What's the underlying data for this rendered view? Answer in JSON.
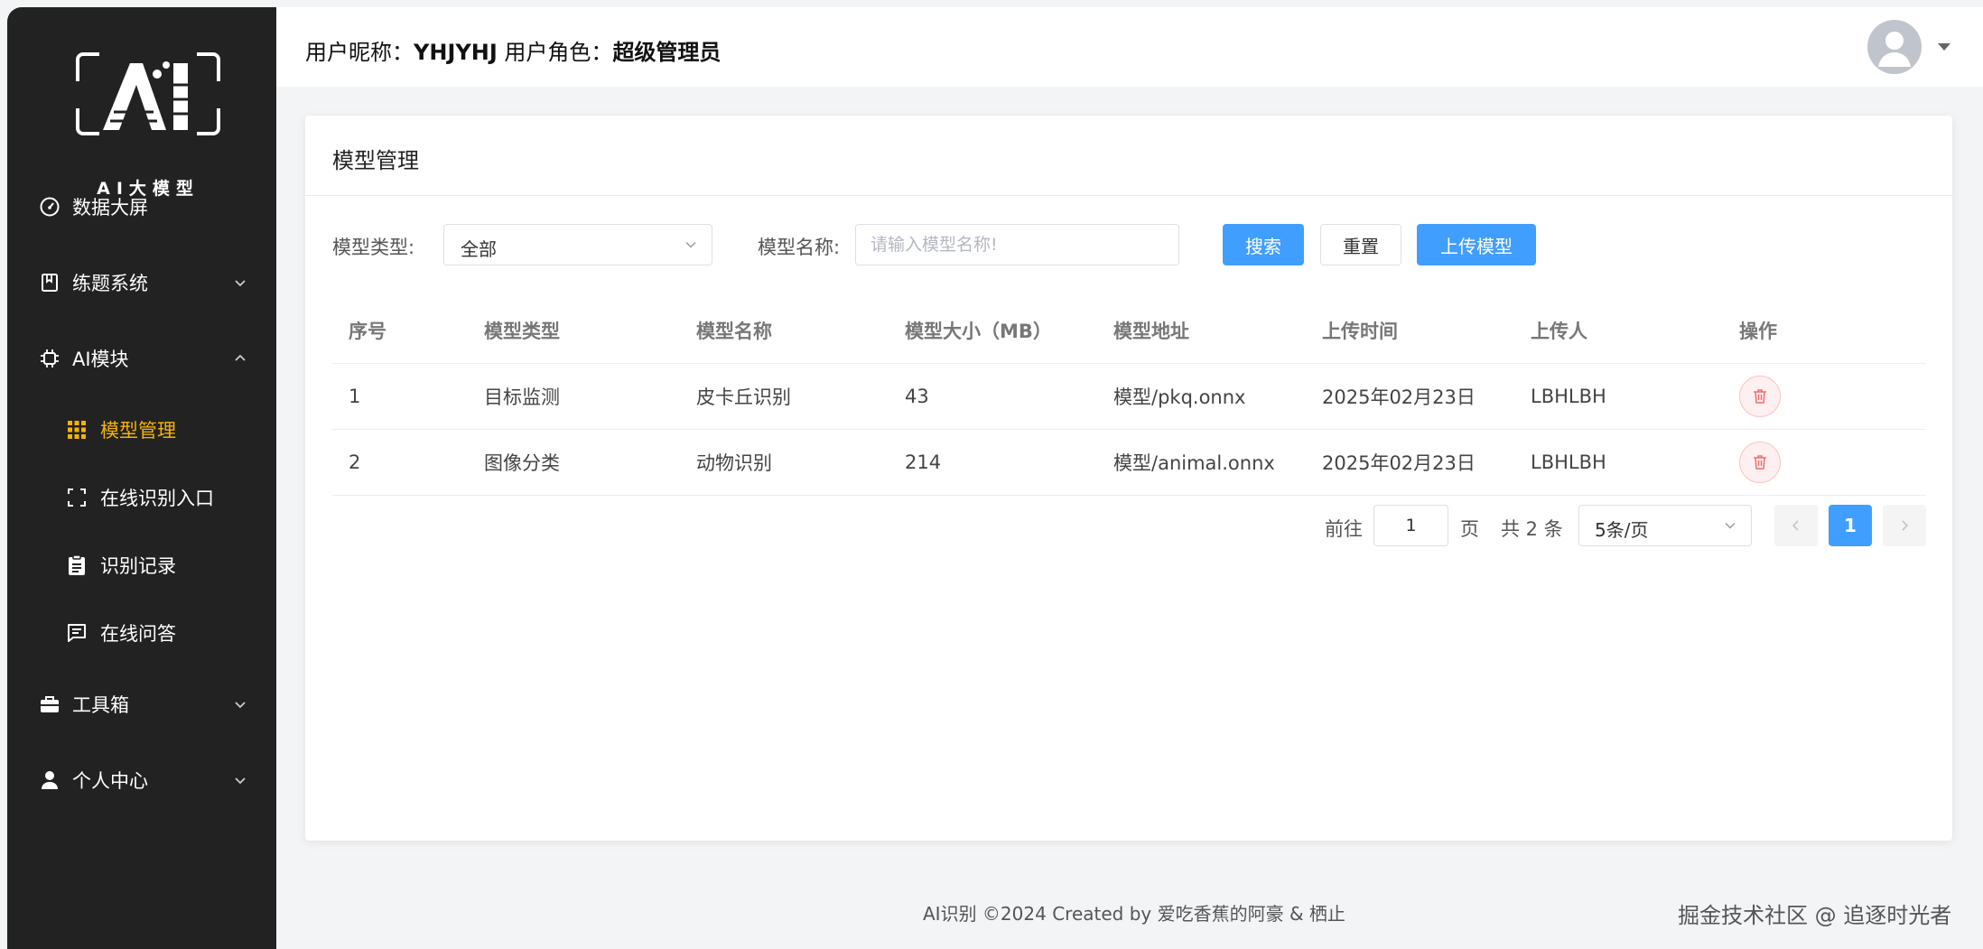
{
  "sidebar": {
    "logo_text": "AI大模型",
    "items": [
      {
        "label": "数据大屏",
        "icon": "dashboard-icon"
      },
      {
        "label": "练题系统",
        "icon": "book-icon"
      },
      {
        "label": "AI模块",
        "icon": "chip-icon"
      },
      {
        "label": "工具箱",
        "icon": "toolbox-icon"
      },
      {
        "label": "个人中心",
        "icon": "user-icon"
      }
    ],
    "ai_sub_items": [
      {
        "label": "模型管理",
        "icon": "grid-icon"
      },
      {
        "label": "在线识别入口",
        "icon": "scan-icon"
      },
      {
        "label": "识别记录",
        "icon": "clipboard-icon"
      },
      {
        "label": "在线问答",
        "icon": "chat-icon"
      }
    ],
    "accent": "#f5b400"
  },
  "header": {
    "nickname_label": "用户昵称：",
    "nickname": "YHJYHJ",
    "role_label": " 用户角色：",
    "role": "超级管理员"
  },
  "card": {
    "title": "模型管理"
  },
  "search": {
    "type_label": "模型类型:",
    "type_value": "全部",
    "name_label": "模型名称:",
    "name_placeholder": "请输入模型名称!",
    "search_button": "搜索",
    "reset_button": "重置",
    "upload_button": "上传模型"
  },
  "table": {
    "columns": [
      "序号",
      "模型类型",
      "模型名称",
      "模型大小（MB）",
      "模型地址",
      "上传时间",
      "上传人",
      "操作"
    ],
    "rows": [
      [
        "1",
        "目标监测",
        "皮卡丘识别",
        "43",
        "模型/pkq.onnx",
        "2025年02月23日",
        "LBHLBH"
      ],
      [
        "2",
        "图像分类",
        "动物识别",
        "214",
        "模型/animal.onnx",
        "2025年02月23日",
        "LBHLBH"
      ]
    ]
  },
  "pagination": {
    "goto_label": "前往",
    "current_page": "1",
    "page_label": "页",
    "total_text": "共 2 条",
    "page_size": "5条/页",
    "page_number": "1"
  },
  "footer": {
    "text": "AI识别 ©2024 Created by 爱吃香蕉的阿豪 & 栖止",
    "watermark": "掘金技术社区 @ 追逐时光者"
  },
  "colors": {
    "primary": "#409eff",
    "sidebar_bg": "#222222",
    "danger": "#f56c6c"
  }
}
